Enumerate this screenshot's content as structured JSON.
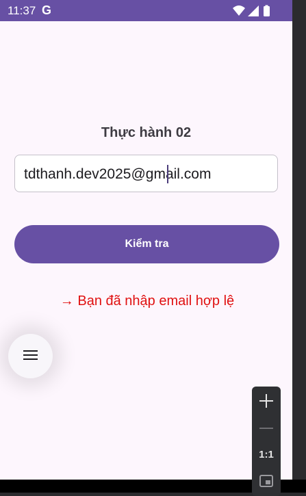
{
  "status_bar": {
    "time": "11:37",
    "g_label": "G",
    "icons": [
      "wifi-icon",
      "signal-icon",
      "battery-icon"
    ]
  },
  "title": "Thực hành 02",
  "email_input": {
    "value": "tdthanh.dev2025@gmail.com"
  },
  "check_button": {
    "label": "Kiểm tra"
  },
  "result_message": "→ Bạn đã nhập email hợp lệ",
  "fab": {
    "icon": "menu-icon"
  },
  "zoom_controls": {
    "zoom_in_icon": "plus-icon",
    "zoom_out_icon": "minus-icon",
    "ratio_label": "1:1",
    "fit_icon": "fit-screen-icon"
  },
  "colors": {
    "primary": "#6750a4",
    "background": "#fdf6fd",
    "success_text": "#e01010"
  }
}
